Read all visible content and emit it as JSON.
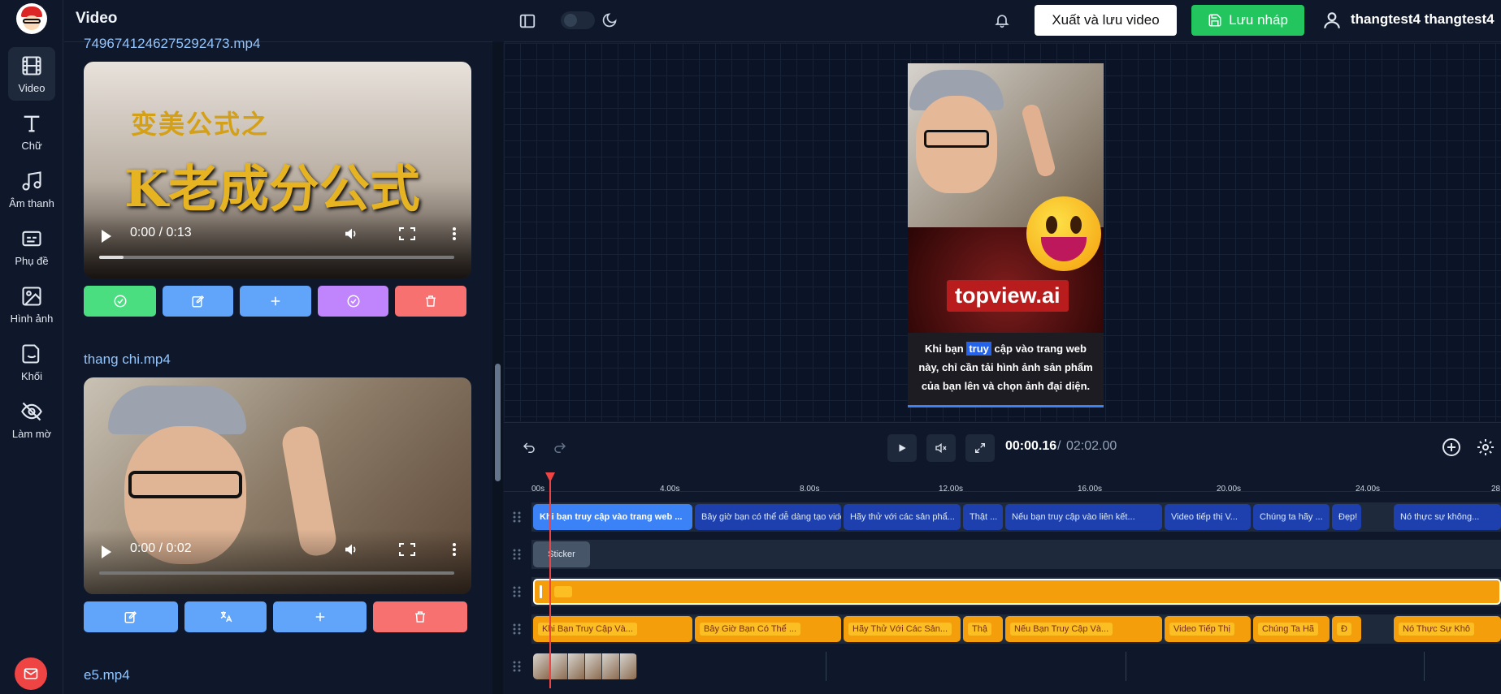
{
  "sidebar": {
    "items": [
      {
        "label": "Video",
        "icon": "film-icon"
      },
      {
        "label": "Chữ",
        "icon": "text-icon"
      },
      {
        "label": "Âm thanh",
        "icon": "music-icon"
      },
      {
        "label": "Phụ đề",
        "icon": "subtitles-icon"
      },
      {
        "label": "Hình ảnh",
        "icon": "image-icon"
      },
      {
        "label": "Khối",
        "icon": "shape-icon"
      },
      {
        "label": "Làm mờ",
        "icon": "eye-off-icon"
      }
    ]
  },
  "panel": {
    "title": "Video",
    "videos": [
      {
        "name": "7496741246275292473.mp4",
        "time": "0:00 / 0:13",
        "overlay_line1": "变美公式之",
        "overlay_line2": "K老成分公式"
      },
      {
        "name": "thang chi.mp4",
        "time": "0:00 / 0:02"
      },
      {
        "name": "e5.mp4"
      }
    ]
  },
  "topbar": {
    "export_label": "Xuất và lưu video",
    "draft_label": "Lưu nháp",
    "user_name": "thangtest4 thangtest4"
  },
  "preview": {
    "brand": "topview.ai",
    "subtitle_before": "Khi bạn",
    "subtitle_highlight": "truy",
    "subtitle_after": "cập vào trang web này, chỉ cần tải hình ảnh sản phẩm của bạn lên và chọn ảnh đại diện."
  },
  "playback": {
    "current_time": "00:00.16",
    "separator": "/",
    "total_time": "02:02.00"
  },
  "timeline": {
    "ruler": [
      "00s",
      "4.00s",
      "8.00s",
      "12.00s",
      "16.00s",
      "20.00s",
      "24.00s",
      "28"
    ],
    "subtitle_clips": [
      "Khi bạn truy cập vào trang web ...",
      "Bây giờ bạn có thể dễ dàng tạo vide...",
      "Hãy thử với các sản phẩ...",
      "Thật ...",
      "Nếu bạn truy cập vào liên kết...",
      "Video tiếp thị V...",
      "Chúng ta hãy ...",
      "Đẹp!",
      "Nó thực sự không..."
    ],
    "sticker_label": "Sticker",
    "voice_clips": [
      "Khi Bạn Truy Cập Và...",
      "Bây Giờ Bạn Có Thể ...",
      "Hãy Thử Với Các Sản...",
      "Thậ",
      "Nếu Bạn Truy Cập Và...",
      "Video Tiếp Thị",
      "Chúng Ta Hã",
      "Đ",
      "Nó Thực Sự Khô"
    ]
  },
  "colors": {
    "accent_blue": "#3b82f6",
    "green": "#22c55e",
    "red": "#ef4444",
    "amber": "#f59e0b"
  }
}
